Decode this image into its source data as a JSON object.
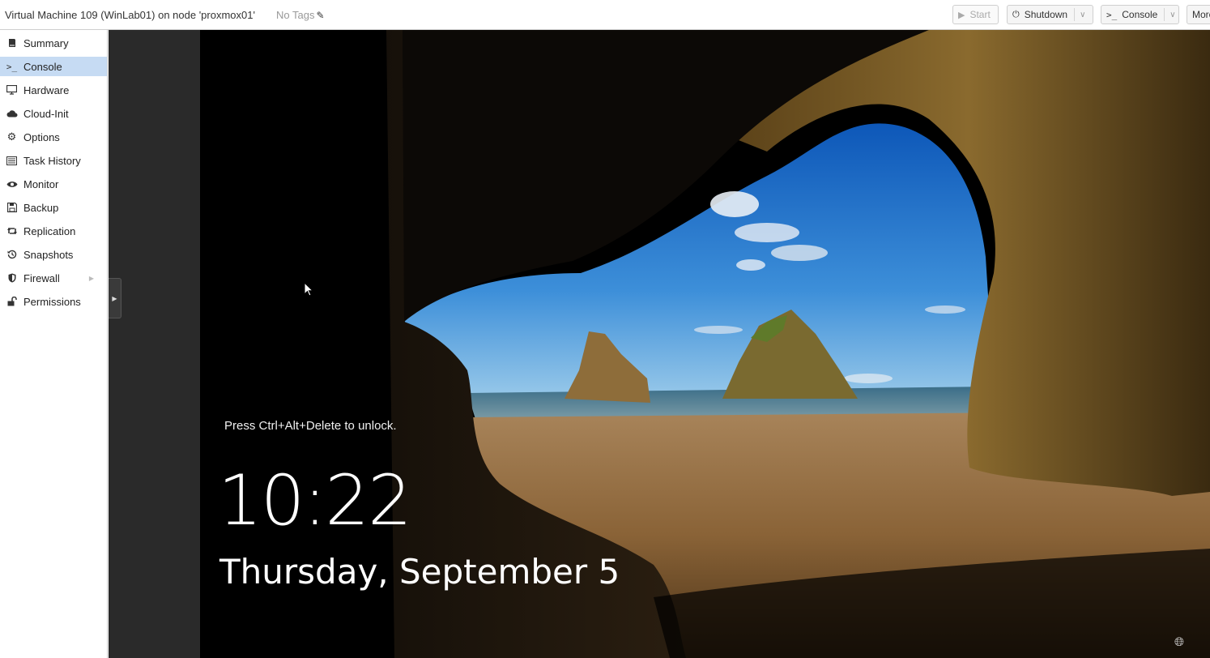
{
  "header": {
    "vm_title": "Virtual Machine 109 (WinLab01) on node 'proxmox01'",
    "tags_label": "No Tags",
    "buttons": {
      "start": "Start",
      "shutdown": "Shutdown",
      "console": "Console",
      "more": "More"
    },
    "icons": {
      "tags_edit": "pencil-icon",
      "start": "play-icon",
      "shutdown": "power-icon",
      "console": "terminal-icon",
      "split": "chevron-down-icon"
    }
  },
  "sidebar": {
    "active": "Console",
    "items": [
      {
        "label": "Summary",
        "icon": "book-icon"
      },
      {
        "label": "Console",
        "icon": "terminal-icon"
      },
      {
        "label": "Hardware",
        "icon": "monitor-icon"
      },
      {
        "label": "Cloud-Init",
        "icon": "cloud-icon"
      },
      {
        "label": "Options",
        "icon": "gear-icon"
      },
      {
        "label": "Task History",
        "icon": "list-icon"
      },
      {
        "label": "Monitor",
        "icon": "eye-icon"
      },
      {
        "label": "Backup",
        "icon": "floppy-icon"
      },
      {
        "label": "Replication",
        "icon": "retweet-icon"
      },
      {
        "label": "Snapshots",
        "icon": "history-icon"
      },
      {
        "label": "Firewall",
        "icon": "shield-icon"
      },
      {
        "label": "Permissions",
        "icon": "unlock-icon"
      }
    ]
  },
  "console": {
    "unlock_text": "Press Ctrl+Alt+Delete to unlock.",
    "time": "10:22",
    "date": "Thursday, September 5"
  },
  "colors": {
    "active_nav": "#c6dbf3",
    "console_bg": "#2a2a2a"
  }
}
